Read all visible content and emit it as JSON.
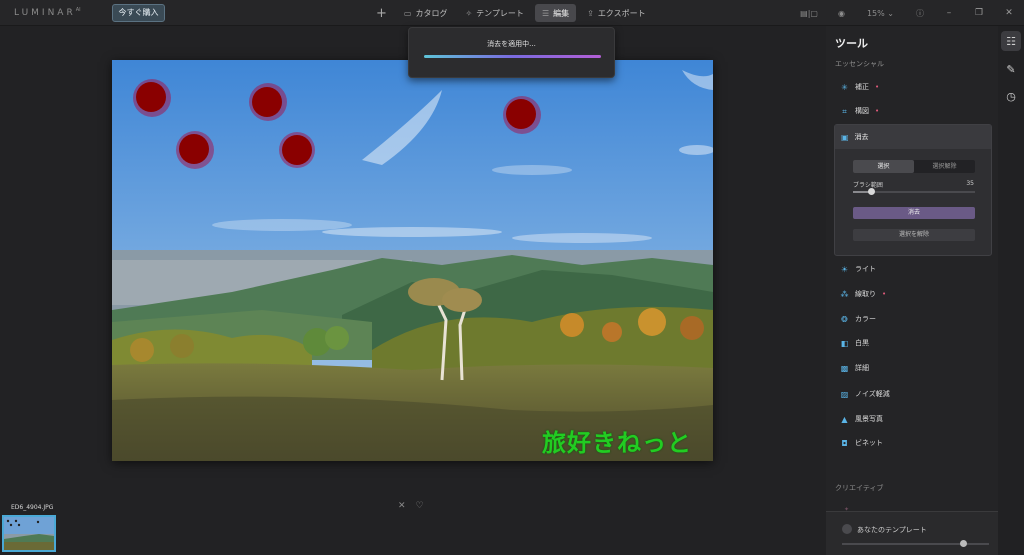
{
  "app": {
    "logo": "LUMINAR",
    "logo_version": "AI",
    "buy_button": "今すぐ購入"
  },
  "topbar": {
    "tabs": [
      {
        "label": "カタログ",
        "icon": "folder-icon"
      },
      {
        "label": "テンプレート",
        "icon": "magic-wand-icon"
      },
      {
        "label": "編集",
        "icon": "sliders-icon"
      },
      {
        "label": "エクスポート",
        "icon": "share-icon"
      }
    ],
    "active_tab": "編集",
    "zoom": "15%"
  },
  "toast": {
    "text": "消去を適用中...",
    "progress": 1.0
  },
  "image": {
    "watermark": "旅好きねっと"
  },
  "filmstrip": {
    "filename": "ED6_4904.JPG"
  },
  "panel": {
    "title": "ツール",
    "section_essentials": "エッセンシャル",
    "tools_top": [
      {
        "label": "補正",
        "icon": "sparkle-icon",
        "modified": true
      },
      {
        "label": "構図",
        "icon": "crop-icon",
        "modified": true
      }
    ],
    "erase": {
      "label": "消去",
      "select": "選択",
      "deselect_tab": "選択解除",
      "brush_label": "ブラシ範囲",
      "brush_value": "35",
      "brush_fraction": 0.15,
      "erase_button": "消去",
      "clear_button": "選択を解除"
    },
    "tools_bottom": [
      {
        "label": "ライト",
        "icon": "sun-icon",
        "modified": false
      },
      {
        "label": "線取り",
        "icon": "structure-icon",
        "modified": true
      },
      {
        "label": "カラー",
        "icon": "color-icon",
        "modified": false
      },
      {
        "label": "白黒",
        "icon": "bw-icon",
        "modified": false
      },
      {
        "label": "詳細",
        "icon": "details-icon",
        "modified": false
      },
      {
        "label": "ノイズ軽減",
        "icon": "noise-icon",
        "modified": false
      },
      {
        "label": "風景写真",
        "icon": "landscape-icon",
        "modified": false
      },
      {
        "label": "ビネット",
        "icon": "vignette-icon",
        "modified": false
      }
    ],
    "section_creative": "クリエイティブ",
    "template_label": "あなたのテンプレート",
    "template_amount": 0.82
  }
}
